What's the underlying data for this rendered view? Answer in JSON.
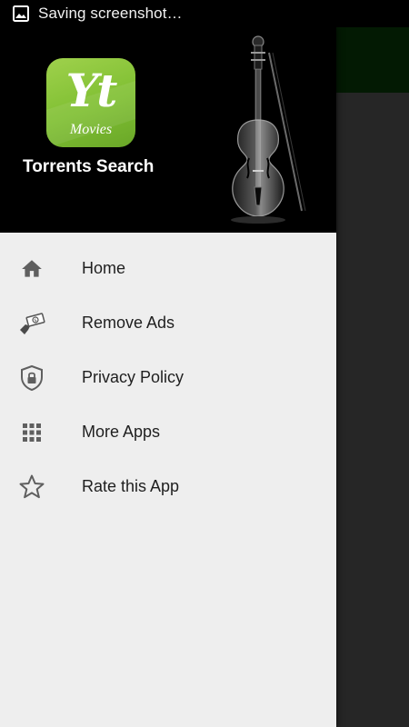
{
  "status_bar": {
    "icon": "image-icon",
    "text": "Saving screenshot…"
  },
  "drawer": {
    "header": {
      "logo_text": "Yt",
      "logo_subtext": "Movies",
      "app_name": "Torrents Search",
      "background_image": "violin"
    },
    "menu_items": [
      {
        "label": "Home",
        "icon": "home-icon"
      },
      {
        "label": "Remove Ads",
        "icon": "money-icon"
      },
      {
        "label": "Privacy Policy",
        "icon": "shield-lock-icon"
      },
      {
        "label": "More Apps",
        "icon": "grid-icon"
      },
      {
        "label": "Rate this App",
        "icon": "star-icon"
      }
    ]
  },
  "colors": {
    "logo_green": "#8cc63f",
    "drawer_bg": "#eeeeee",
    "header_bg": "#000000",
    "toolbar_behind": "#031a03"
  }
}
